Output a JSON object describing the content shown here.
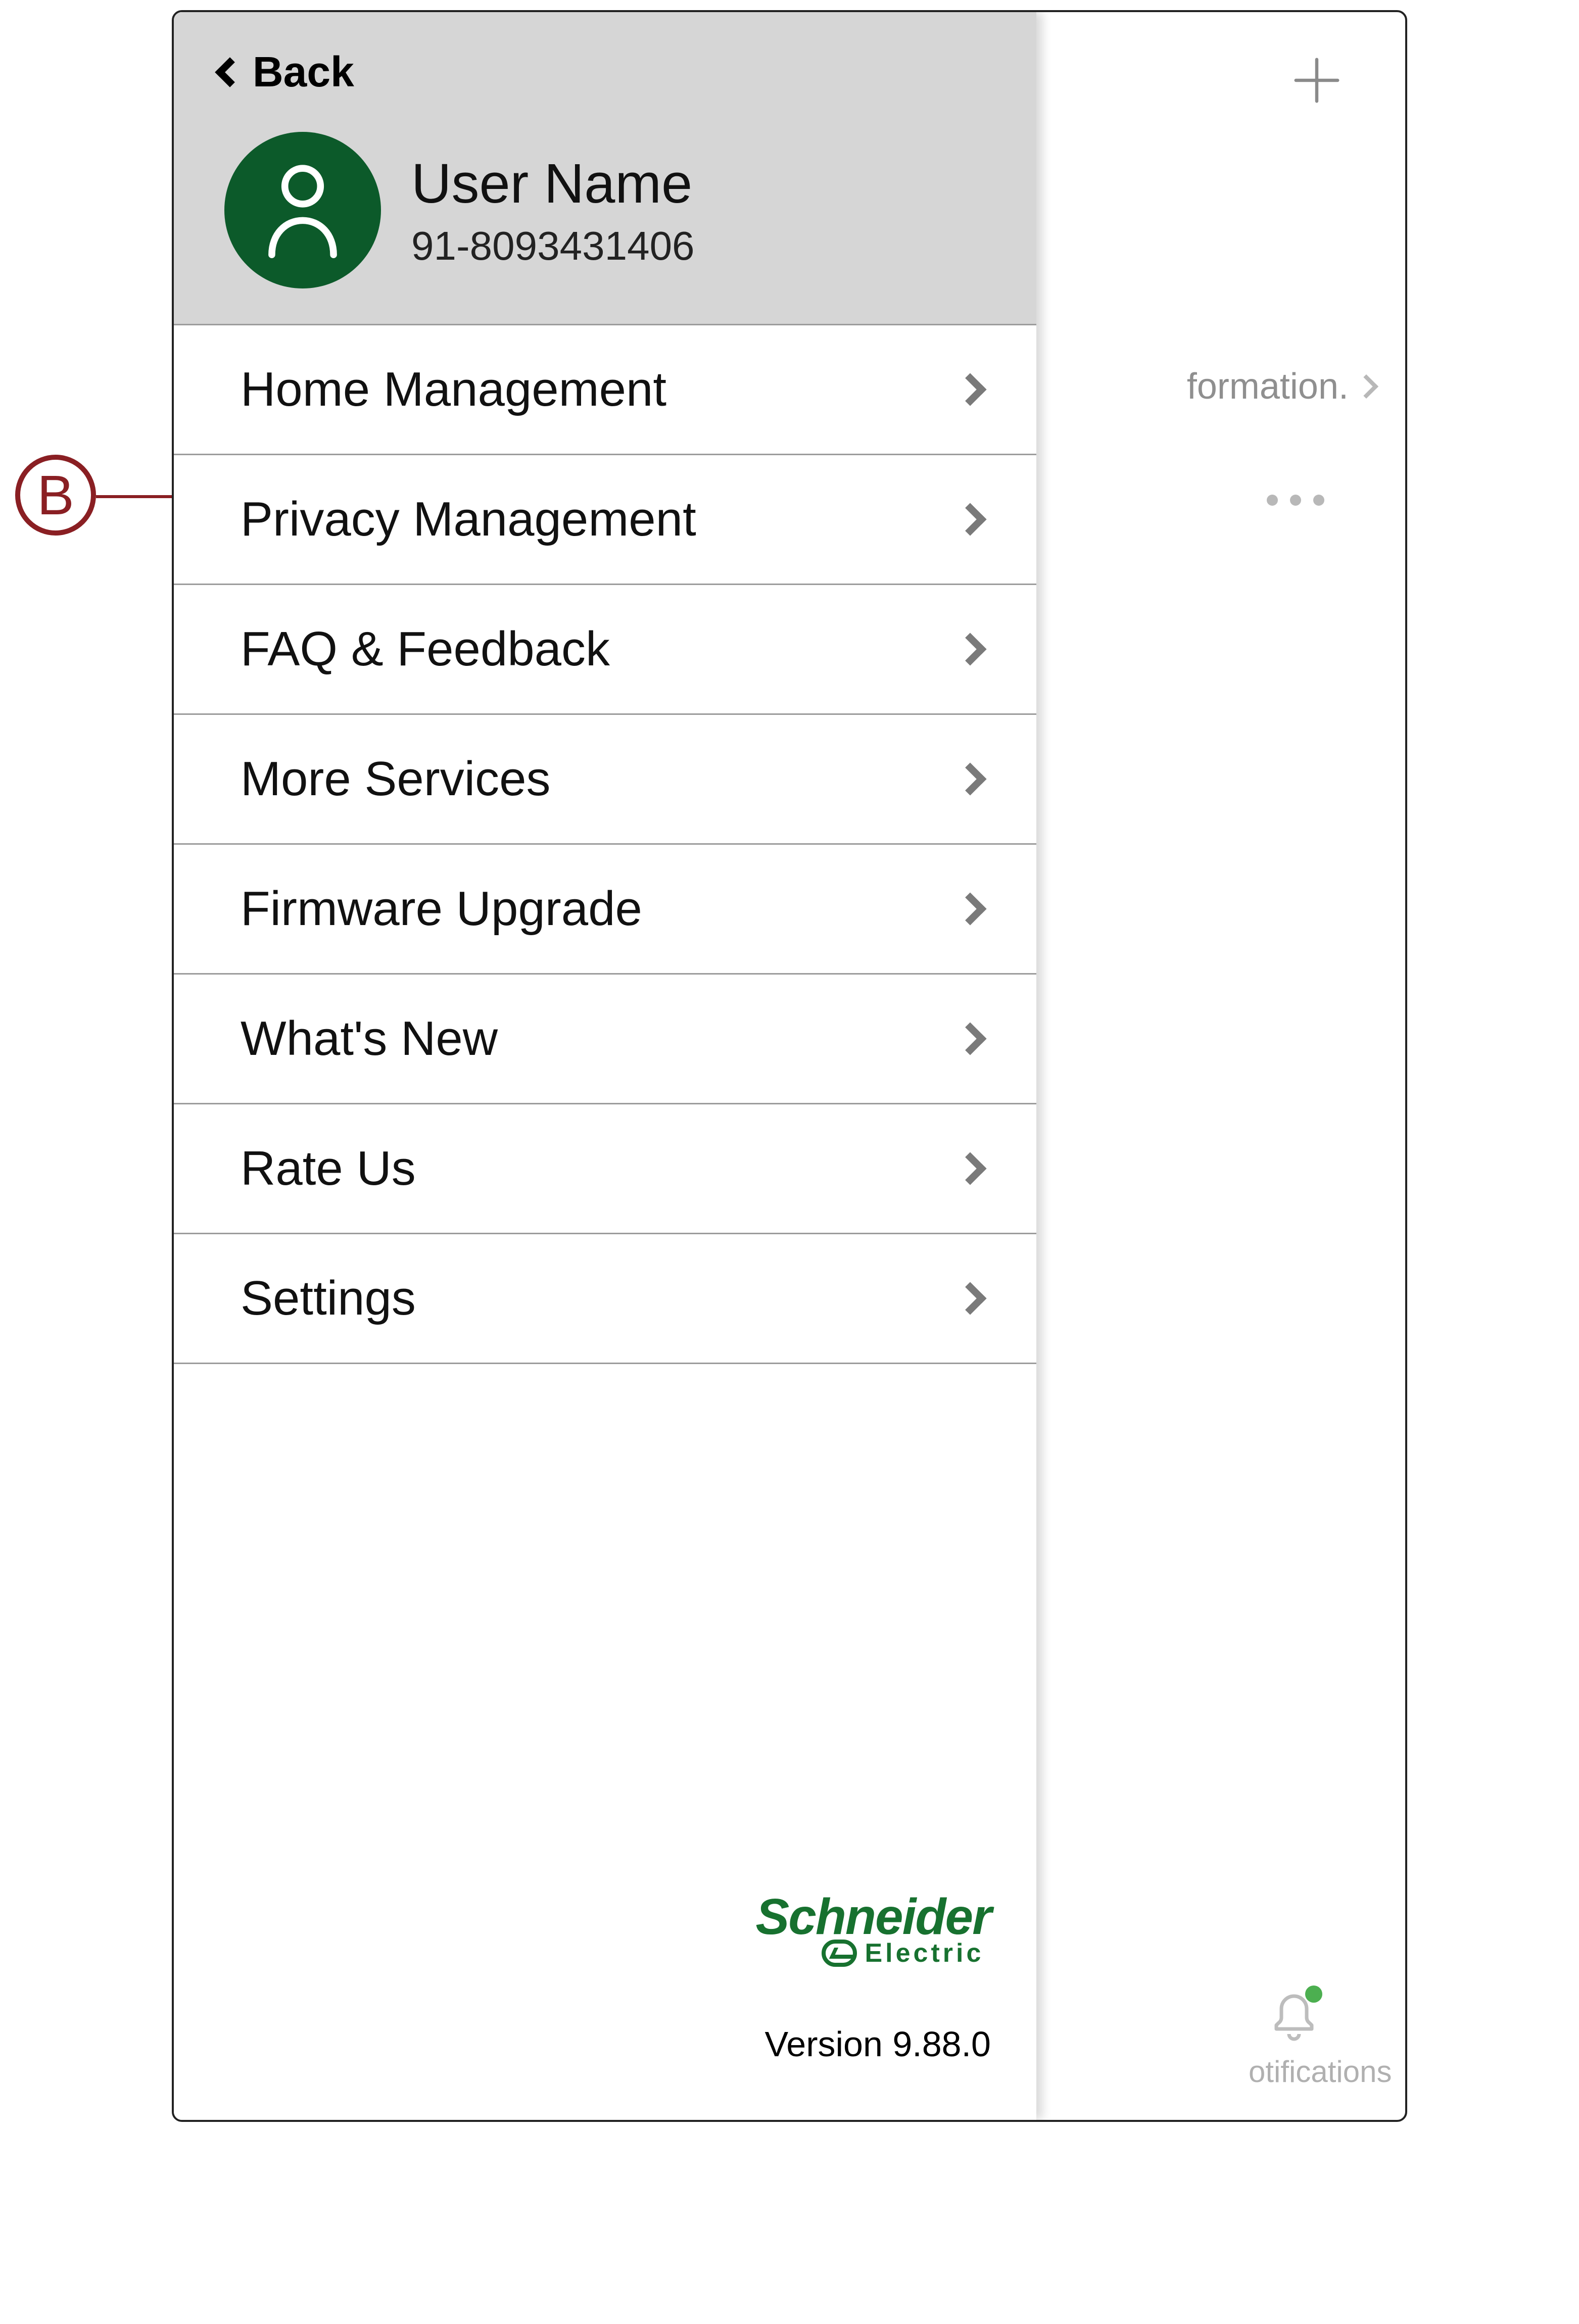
{
  "callout": {
    "letter": "B"
  },
  "background": {
    "formation_fragment": "formation.",
    "notifications_fragment": "otifications"
  },
  "drawer": {
    "back_label": "Back",
    "profile": {
      "name": "User Name",
      "phone": "91-8093431406"
    },
    "menu": [
      {
        "label": "Home Management"
      },
      {
        "label": "Privacy Management"
      },
      {
        "label": "FAQ & Feedback"
      },
      {
        "label": "More Services"
      },
      {
        "label": "Firmware Upgrade"
      },
      {
        "label": "What's New"
      },
      {
        "label": "Rate Us"
      },
      {
        "label": "Settings"
      }
    ],
    "brand": {
      "name": "Schneider",
      "sub": "Electric"
    },
    "version": "Version 9.88.0"
  }
}
